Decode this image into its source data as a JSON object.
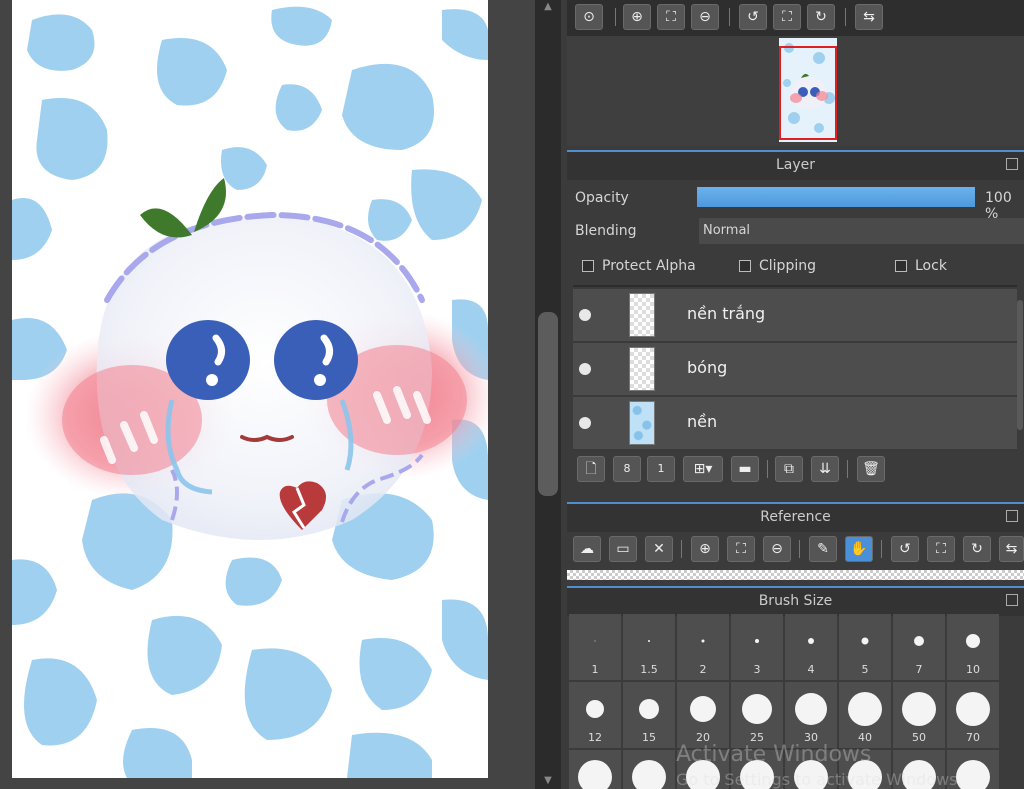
{
  "panel": {
    "navigator_tools": [
      "zoom-reset-icon",
      "zoom-in-icon",
      "fit-icon",
      "zoom-out-icon",
      "rotate-left-icon",
      "fullscreen-icon",
      "rotate-right-icon",
      "flip-icon"
    ],
    "layer_header": "Layer",
    "opacity_label": "Opacity",
    "opacity_value": "100 %",
    "opacity_fraction": 1.0,
    "blending_label": "Blending",
    "blending_value": "Normal",
    "protect_alpha_label": "Protect Alpha",
    "clipping_label": "Clipping",
    "lock_label": "Lock",
    "layers": [
      {
        "name": "nền trắng"
      },
      {
        "name": "bóng"
      },
      {
        "name": "nền"
      }
    ],
    "reference_header": "Reference",
    "brush_header": "Brush Size",
    "brush_sizes": [
      "1",
      "1.5",
      "2",
      "3",
      "4",
      "5",
      "7",
      "10",
      "12",
      "15",
      "20",
      "25",
      "30",
      "40",
      "50",
      "70"
    ],
    "watermark_line1": "Activate Windows",
    "watermark_line2": "Go to Settings to activate Windows."
  },
  "colors": {
    "accent": "#4f8fd0",
    "opacity_bar": "#5ea8e8",
    "cow_spot": "#9fd0f0",
    "blush": "#f08a96",
    "eye": "#3a5fb8",
    "leaf": "#3f7a2c"
  }
}
